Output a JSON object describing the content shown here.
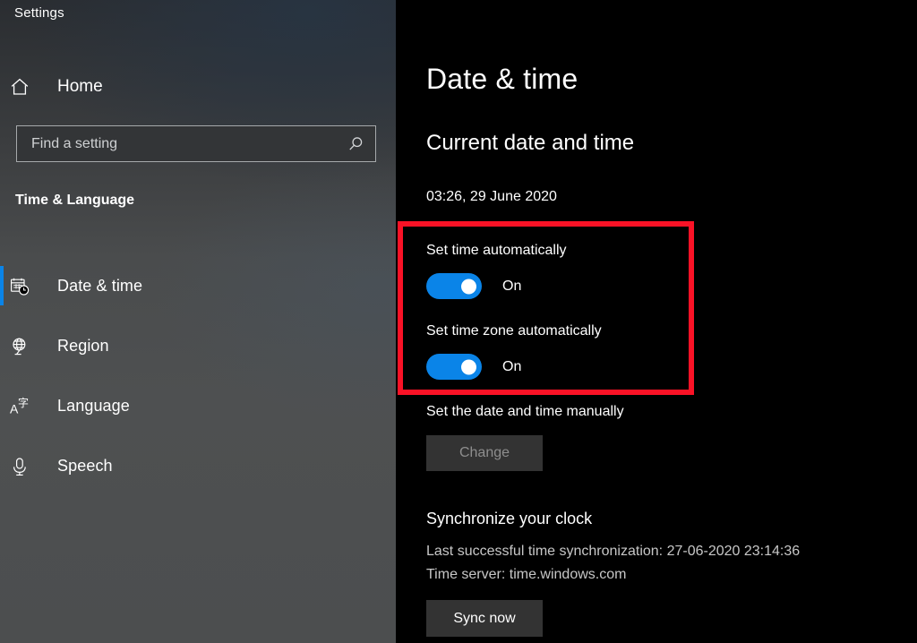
{
  "window": {
    "title": "Settings"
  },
  "sidebar": {
    "home": {
      "label": "Home",
      "icon": "home-icon"
    },
    "search": {
      "placeholder": "Find a setting",
      "value": "",
      "icon": "search-icon"
    },
    "category_title": "Time & Language",
    "items": [
      {
        "label": "Date & time",
        "icon": "calendar-clock-icon",
        "selected": true
      },
      {
        "label": "Region",
        "icon": "globe-icon",
        "selected": false
      },
      {
        "label": "Language",
        "icon": "language-icon",
        "selected": false
      },
      {
        "label": "Speech",
        "icon": "microphone-icon",
        "selected": false
      }
    ]
  },
  "main": {
    "page_title": "Date & time",
    "sections": {
      "current": {
        "heading": "Current date and time",
        "datetime": "03:26, 29 June 2020"
      },
      "auto_time": {
        "label": "Set time automatically",
        "state": "On",
        "on": true
      },
      "auto_timezone": {
        "label": "Set time zone automatically",
        "state": "On",
        "on": true
      },
      "manual": {
        "label": "Set the date and time manually",
        "button_label": "Change",
        "button_disabled": true
      },
      "sync": {
        "heading": "Synchronize your clock",
        "last_sync": "Last successful time synchronization: 27-06-2020 23:14:36",
        "time_server": "Time server: time.windows.com",
        "button_label": "Sync now"
      }
    }
  },
  "annotation": {
    "highlight_color": "#fa1226",
    "accent_color": "#0a84e8"
  }
}
